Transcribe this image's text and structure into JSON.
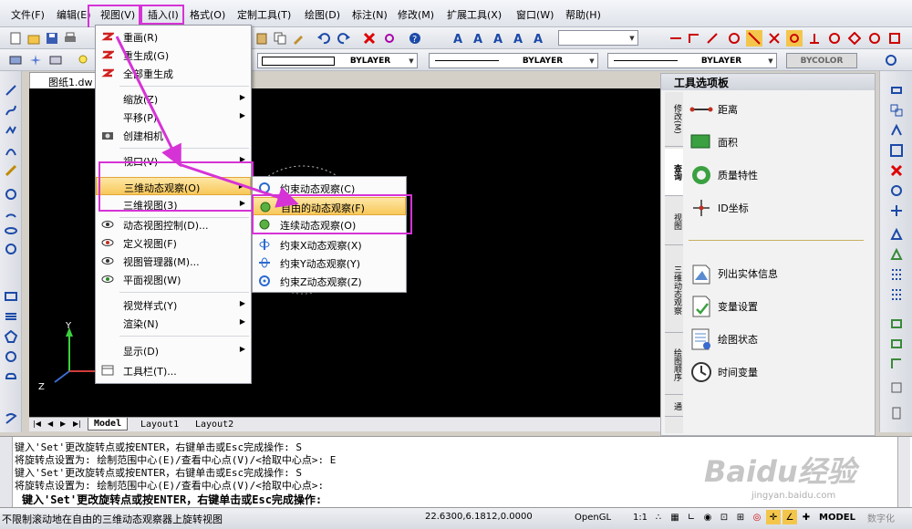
{
  "menubar": {
    "items": [
      "文件(F)",
      "编辑(E)",
      "视图(V)",
      "插入(I)",
      "格式(O)",
      "定制工具(T)",
      "绘图(D)",
      "标注(N)",
      "修改(M)",
      "扩展工具(X)",
      "窗口(W)",
      "帮助(H)"
    ]
  },
  "props_toolbar": {
    "linetype1": "BYLAYER",
    "linetype2": "BYLAYER",
    "linetype3": "BYLAYER",
    "color": "BYCOLOR"
  },
  "drawing_tab": "图纸1.dw",
  "view_menu": {
    "items": [
      {
        "label": "重画(R)",
        "icon": "redraw-icon",
        "sub": false
      },
      {
        "label": "重生成(G)",
        "icon": "regen-icon",
        "sub": false
      },
      {
        "label": "全部重生成",
        "icon": "regen-all-icon",
        "sub": false
      },
      {
        "label": "缩放(Z)",
        "icon": "",
        "sub": true
      },
      {
        "label": "平移(P)",
        "icon": "",
        "sub": true
      },
      {
        "label": "创建相机",
        "icon": "camera-icon",
        "sub": false
      },
      {
        "label": "视口(V)",
        "icon": "",
        "sub": true
      },
      {
        "label": "三维动态观察(O)",
        "icon": "",
        "sub": true
      },
      {
        "label": "三维视图(3)",
        "icon": "",
        "sub": true
      },
      {
        "label": "动态视图控制(D)...",
        "icon": "eye-icon",
        "sub": false
      },
      {
        "label": "定义视图(F)",
        "icon": "eye-icon",
        "sub": false
      },
      {
        "label": "视图管理器(M)...",
        "icon": "eye-icon",
        "sub": false
      },
      {
        "label": "平面视图(W)",
        "icon": "eye-icon",
        "sub": false
      },
      {
        "label": "视觉样式(Y)",
        "icon": "",
        "sub": true
      },
      {
        "label": "渲染(N)",
        "icon": "",
        "sub": true
      },
      {
        "label": "显示(D)",
        "icon": "",
        "sub": true
      },
      {
        "label": "工具栏(T)...",
        "icon": "toolbar-icon",
        "sub": false
      }
    ]
  },
  "orbit_menu": {
    "items": [
      {
        "label": "约束动态观察(C)",
        "icon": "orbit-icon"
      },
      {
        "label": "自由的动态观察(F)",
        "icon": "free-orbit-icon"
      },
      {
        "label": "连续动态观察(O)",
        "icon": "continuous-orbit-icon"
      },
      {
        "label": "约束X动态观察(X)",
        "icon": "orbit-x-icon"
      },
      {
        "label": "约束Y动态观察(Y)",
        "icon": "orbit-y-icon"
      },
      {
        "label": "约束Z动态观察(Z)",
        "icon": "orbit-z-icon"
      }
    ]
  },
  "tool_palette": {
    "title": "工具选项板",
    "tabs": [
      "修改(M)",
      "查询",
      "视图",
      "三维动态观察",
      "绘图顺序",
      "通"
    ],
    "items": [
      {
        "label": "距离",
        "icon": "distance-icon"
      },
      {
        "label": "面积",
        "icon": "area-icon"
      },
      {
        "label": "质量特性",
        "icon": "mass-properties-icon"
      },
      {
        "label": "ID坐标",
        "icon": "id-point-icon"
      },
      {
        "label": "列出实体信息",
        "icon": "list-info-icon"
      },
      {
        "label": "变量设置",
        "icon": "setvar-icon"
      },
      {
        "label": "绘图状态",
        "icon": "status-icon"
      },
      {
        "label": "时间变量",
        "icon": "time-icon"
      }
    ]
  },
  "layout_tabs": [
    "Model",
    "Layout1",
    "Layout2"
  ],
  "axis": {
    "y": "Y",
    "z": "Z"
  },
  "command_lines": [
    "键入'Set'更改旋转点或按ENTER，右键单击或Esc完成操作: S",
    "将旋转点设置为: 绘制范围中心(E)/查看中心点(V)/<拾取中心点>: E",
    "键入'Set'更改旋转点或按ENTER，右键单击或Esc完成操作: S",
    "将旋转点设置为: 绘制范围中心(E)/查看中心点(V)/<拾取中心点>:"
  ],
  "command_prompt": "键入'Set'更改旋转点或按ENTER，右键单击或Esc完成操作:",
  "status": {
    "message": "不限制滚动地在自由的三维动态观察器上旋转视图",
    "coords": "22.6300,6.1812,0.0000",
    "opengl": "OpenGL",
    "scale": "1:1",
    "model": "MODEL",
    "digitizer": "数字化"
  },
  "watermark": {
    "brand": "Baidu经验",
    "url": "jingyan.baidu.com"
  },
  "colors": {
    "highlight": "#f8c85a",
    "annotation": "#d633d6",
    "canvas": "#000000"
  }
}
